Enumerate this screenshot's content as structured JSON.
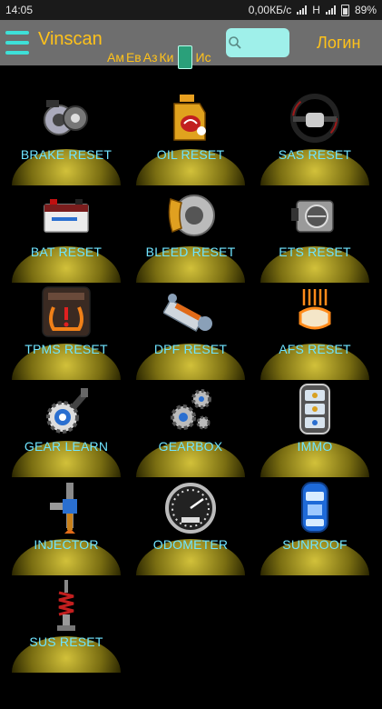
{
  "status_bar": {
    "time": "14:05",
    "net_speed": "0,00КБ/с",
    "network": "H",
    "battery": "89%"
  },
  "toolbar": {
    "title": "Vinscan",
    "lang_text_1": "Ам",
    "lang_text_2": "Ев",
    "lang_text_3": "Аз",
    "lang_text_4": "Ки",
    "lang_text_5": "Ис",
    "login_label": "Логин",
    "search_value": ""
  },
  "tiles": [
    {
      "label": "BRAKE RESET",
      "icon": "brake-disc-icon"
    },
    {
      "label": "OIL RESET",
      "icon": "oil-can-icon"
    },
    {
      "label": "SAS RESET",
      "icon": "steering-wheel-icon"
    },
    {
      "label": "BAT RESET",
      "icon": "battery-icon"
    },
    {
      "label": "BLEED RESET",
      "icon": "brake-caliper-icon"
    },
    {
      "label": "ETS RESET",
      "icon": "throttle-body-icon"
    },
    {
      "label": "TPMS RESET",
      "icon": "tpms-warning-icon"
    },
    {
      "label": "DPF RESET",
      "icon": "particulate-filter-icon"
    },
    {
      "label": "AFS RESET",
      "icon": "headlight-icon"
    },
    {
      "label": "GEAR LEARN",
      "icon": "gear-wrench-icon"
    },
    {
      "label": "GEARBOX",
      "icon": "gears-icon"
    },
    {
      "label": "IMMO",
      "icon": "key-fob-icon"
    },
    {
      "label": "INJECTOR",
      "icon": "injector-icon"
    },
    {
      "label": "ODOMETER",
      "icon": "odometer-icon"
    },
    {
      "label": "SUNROOF",
      "icon": "car-sunroof-icon"
    },
    {
      "label": "SUS RESET",
      "icon": "suspension-icon"
    }
  ],
  "colors": {
    "accent": "#ffc21a",
    "label": "#6fe4ff",
    "toolbar": "#6e6e6e",
    "menu_icon": "#3ee0d8"
  }
}
